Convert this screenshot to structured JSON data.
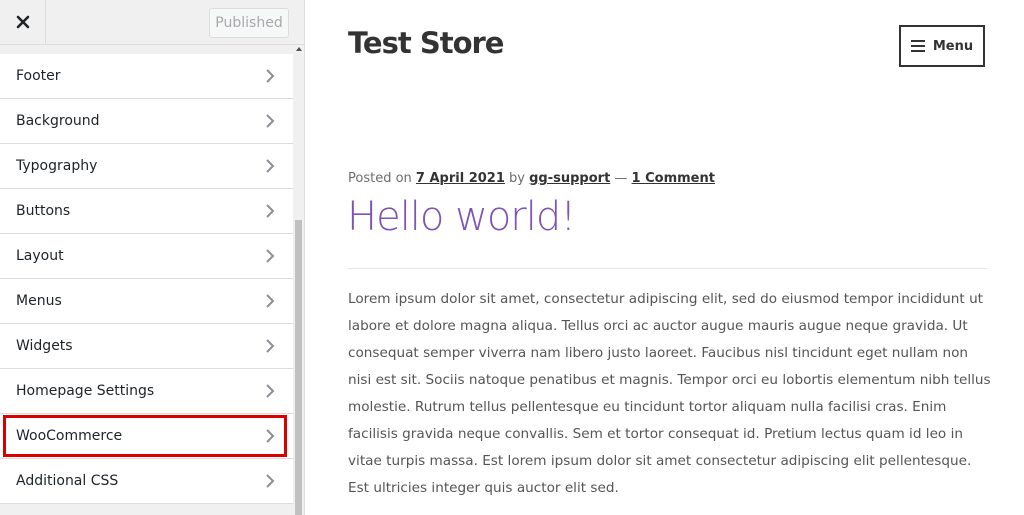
{
  "sidebar": {
    "close_label": "×",
    "publish_label": "Published",
    "items": [
      {
        "label": "Footer"
      },
      {
        "label": "Background"
      },
      {
        "label": "Typography"
      },
      {
        "label": "Buttons"
      },
      {
        "label": "Layout"
      },
      {
        "label": "Menus"
      },
      {
        "label": "Widgets"
      },
      {
        "label": "Homepage Settings"
      },
      {
        "label": "WooCommerce",
        "highlighted": true
      },
      {
        "label": "Additional CSS"
      }
    ]
  },
  "preview": {
    "site_title": "Test Store",
    "menu_label": "Menu",
    "post": {
      "meta_prefix": "Posted on ",
      "date": "7 April 2021",
      "by": " by ",
      "author": "gg-support",
      "sep": " — ",
      "comments": "1 Comment",
      "title": "Hello world!",
      "body": "Lorem ipsum dolor sit amet, consectetur adipiscing elit, sed do eiusmod tempor incididunt ut labore et dolore magna aliqua. Tellus orci ac auctor augue mauris augue neque gravida. Ut consequat semper viverra nam libero justo laoreet. Faucibus nisl tincidunt eget nullam non nisi est sit. Sociis natoque penatibus et magnis. Tempor orci eu lobortis elementum nibh tellus molestie. Rutrum tellus pellentesque eu tincidunt tortor aliquam nulla facilisi cras. Enim facilisis gravida neque convallis. Sem et tortor consequat id. Pretium lectus quam id leo in vitae turpis massa. Est lorem ipsum dolor sit amet consectetur adipiscing elit pellentesque. Est ultricies integer quis auctor elit sed."
    }
  },
  "colors": {
    "highlight": "#d90000",
    "post_title": "#7f54b3",
    "text": "#333333"
  }
}
